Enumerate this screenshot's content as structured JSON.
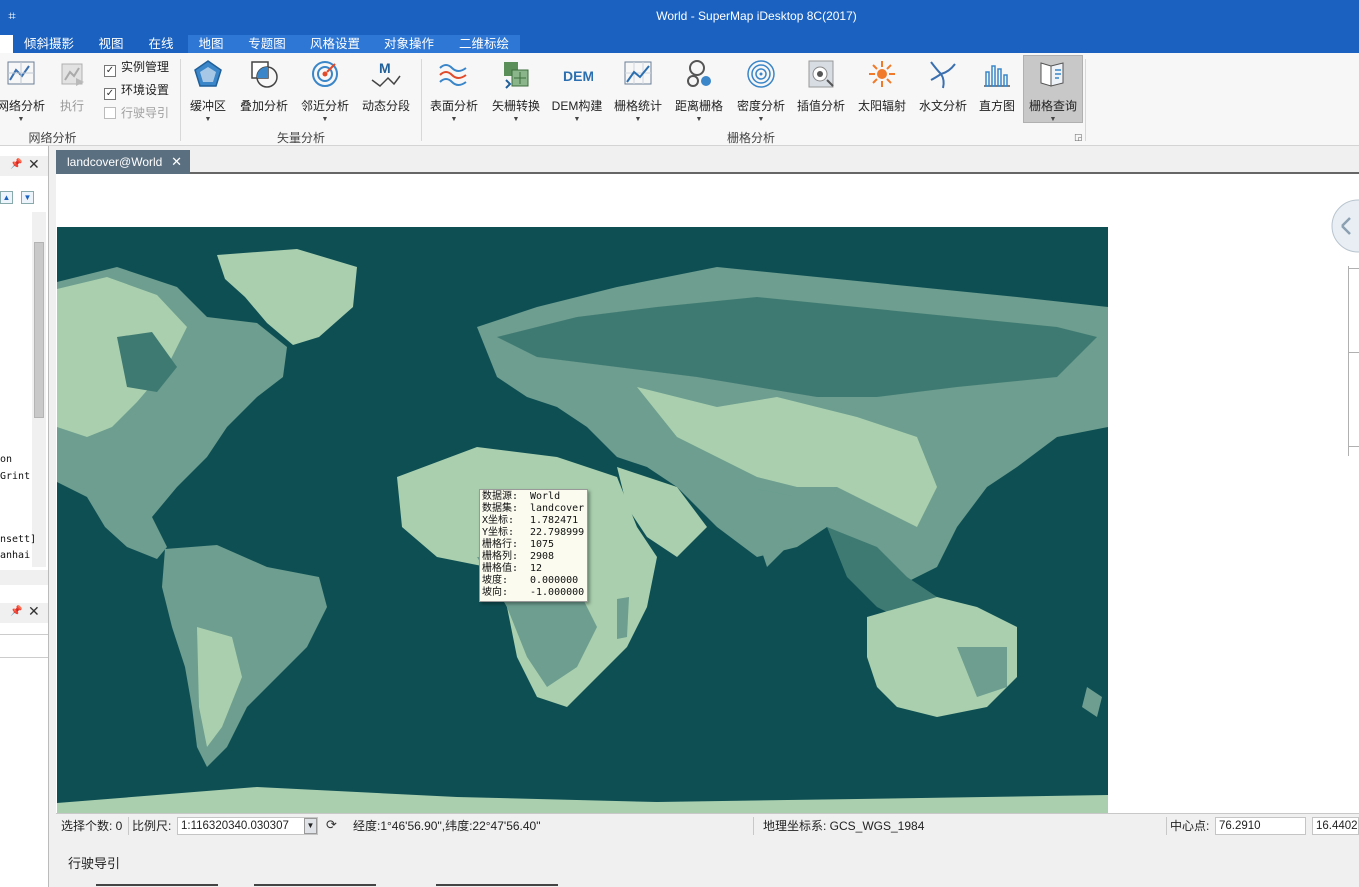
{
  "window": {
    "title": "World - SuperMap iDesktop 8C(2017)",
    "app_icon": "app-icon"
  },
  "tabs": [
    {
      "label": "倾斜摄影"
    },
    {
      "label": "视图"
    },
    {
      "label": "在线"
    },
    {
      "label": "地图"
    },
    {
      "label": "专题图"
    },
    {
      "label": "风格设置"
    },
    {
      "label": "对象操作"
    },
    {
      "label": "二维标绘"
    }
  ],
  "ribbon": {
    "network_group": {
      "label": "网络分析",
      "network_button": "网络分析",
      "run_button": "执行",
      "instance_mgmt": "实例管理",
      "env_settings": "环境设置",
      "drive_guide": "行驶导引"
    },
    "vector_group": {
      "label": "矢量分析",
      "buttons": [
        "缓冲区",
        "叠加分析",
        "邻近分析",
        "动态分段"
      ]
    },
    "raster_group": {
      "label": "栅格分析",
      "buttons": [
        "表面分析",
        "矢栅转换",
        "DEM构建",
        "栅格统计",
        "距离栅格",
        "密度分析",
        "插值分析",
        "太阳辐射",
        "水文分析",
        "直方图",
        "栅格查询"
      ]
    }
  },
  "left_panel": {
    "text_lines": [
      "on",
      "Grint",
      "nsett]",
      "anhai"
    ]
  },
  "document": {
    "tab_label": "landcover@World"
  },
  "tooltip": {
    "rows": [
      {
        "key": "数据源:",
        "value": "World"
      },
      {
        "key": "数据集:",
        "value": "landcover"
      },
      {
        "key": "X坐标:",
        "value": "1.782471"
      },
      {
        "key": "Y坐标:",
        "value": "22.798999"
      },
      {
        "key": "栅格行:",
        "value": "1075"
      },
      {
        "key": "栅格列:",
        "value": "2908"
      },
      {
        "key": "栅格值:",
        "value": "12"
      },
      {
        "key": "坡度:",
        "value": "0.000000"
      },
      {
        "key": "坡向:",
        "value": "-1.000000"
      }
    ]
  },
  "statusbar": {
    "selected_count": "选择个数: 0",
    "scale_label": "比例尺:",
    "scale_value": "1:116320340.030307",
    "coords": "经度:1°46'56.90\",纬度:22°47'56.40\"",
    "crs": "地理坐标系: GCS_WGS_1984",
    "center_label": "中心点:",
    "center_x": "76.2910",
    "center_y": "16.4402"
  },
  "bottom_panel": {
    "title": "行驶导引"
  },
  "colors": {
    "title_bar": "#1b62c0",
    "ocean": "#0e4f54",
    "land_light": "#a9cfae",
    "land_mid": "#6d9e8f",
    "land_dark": "#3f7a72"
  }
}
